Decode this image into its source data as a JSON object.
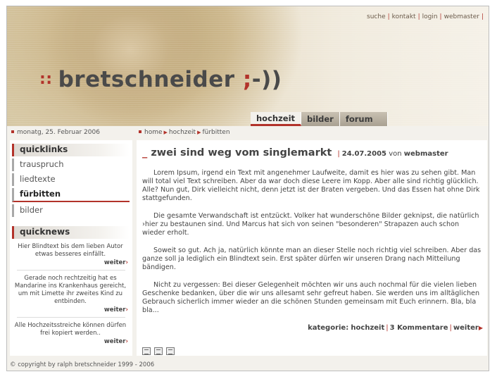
{
  "topnav": {
    "items": [
      "suche",
      "kontakt",
      "login",
      "webmaster"
    ]
  },
  "logo": {
    "dots": "::",
    "name": "bretschneider",
    "smiley_semi": ";",
    "smiley_rest": "-))"
  },
  "tabs": [
    "hochzeit",
    "bilder",
    "forum"
  ],
  "active_tab": "hochzeit",
  "date": "monatg, 25. Februar 2006",
  "breadcrumb": [
    "home",
    "hochzeit",
    "fürbitten"
  ],
  "quicklinks": {
    "title": "quicklinks",
    "items": [
      "trauspruch",
      "liedtexte",
      "fürbitten",
      "bilder"
    ],
    "active": "fürbitten"
  },
  "quicknews": {
    "title": "quicknews",
    "items": [
      {
        "text": "Hier Blindtext bis dem lieben Autor etwas besseres einfällt.",
        "more": "weiter"
      },
      {
        "text": "Gerade noch rechtzeitig hat es Mandarine ins Krankenhaus gereicht, um mit Limette ihr zweites Kind zu entbinden.",
        "more": "weiter"
      },
      {
        "text": "Alle Hochzeitsstreiche können dürfen frei kopiert werden..",
        "more": "weiter"
      }
    ]
  },
  "post": {
    "underscore": "_",
    "title": "zwei sind weg vom singlemarkt",
    "date": "24.07.2005",
    "von": "von",
    "author": "webmaster",
    "paragraphs": [
      "Lorem Ipsum, irgend ein Text mit angenehmer Laufweite, damit es hier was zu sehen gibt. Man will total viel Text schreiben. Aber da war doch diese Leere im Kopp. Aber alle sind richtig glücklich. Alle? Nun gut, Dirk vielleicht nicht, denn jetzt ist der Braten vergeben. Und das Essen hat ohne Dirk stattgefunden.",
      "Die gesamte Verwandschaft ist entzückt. Volker hat wunderschöne Bilder geknipst, die natürlich ›hier zu bestaunen sind. Und Marcus hat sich von seinen \"besonderen\" Strapazen auch schon wieder erholt.",
      "Soweit so gut. Ach ja, natürlich könnte man an dieser Stelle noch richtig viel schreiben. Aber das ganze soll ja lediglich ein Blindtext sein. Erst später dürfen wir unseren Drang nach Mitteilung bändigen.",
      "Nicht zu vergessen: Bei dieser Gelegenheit möchten wir uns auch nochmal für die vielen lieben Geschenke bedanken, über die wir uns allesamt sehr gefreut haben. Sie werden uns im alltäglichen Gebrauch sicherlich immer wieder an die schönen Stunden gemeinsam mit Euch erinnern. Bla, bla bla..."
    ],
    "kategorie_label": "kategorie:",
    "kategorie": "hochzeit",
    "comments": "3 Kommentare",
    "more": "weiter"
  },
  "footer": "© copyright by ralph bretschneider 1999 - 2006",
  "colors": {
    "accent": "#b2322a",
    "background": "#f3f1ec"
  }
}
